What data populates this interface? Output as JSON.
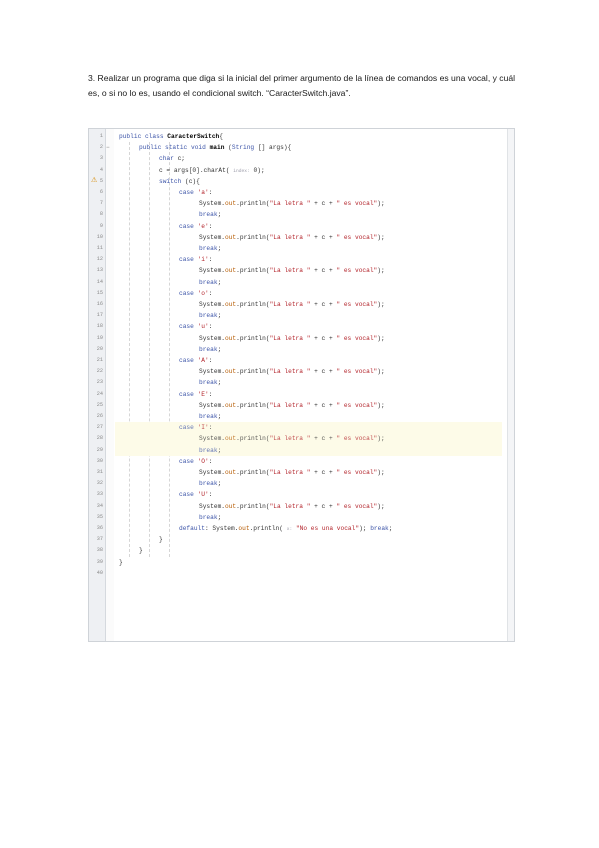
{
  "instruction": "3. Realizar un programa que diga si la inicial del primer argumento de la línea de comandos es una vocal, y cuál es, o si no lo es, usando el condicional switch. “CaracterSwitch.java”.",
  "code_lines": [
    {
      "n": "1",
      "html": "<span class='kw'>public class</span> <span class='bold'>CaracterSwitch</span>{",
      "indent": 0
    },
    {
      "n": "2",
      "html": "<span class='kw'>public static void</span> <span class='bold'>main</span> (<span class='kw'>String</span> [] args){",
      "indent": 1
    },
    {
      "n": "3",
      "html": "<span class='kw'>char</span> c;",
      "indent": 2
    },
    {
      "n": "4",
      "html": "c = args[0].charAt( <span class='hint'>index:</span> 0);",
      "indent": 2
    },
    {
      "n": "5",
      "html": "<span class='kw'>switch</span> (c){",
      "indent": 2
    },
    {
      "n": "6",
      "html": "<span class='kw'>case</span> <span class='str'>'a'</span>:",
      "indent": 3
    },
    {
      "n": "7",
      "html": "System.<span class='field'>out</span>.println(<span class='str'>\"La letra \"</span> + c + <span class='str'>\" es vocal\"</span>);",
      "indent": 4
    },
    {
      "n": "8",
      "html": "<span class='kw'>break</span>;",
      "indent": 4
    },
    {
      "n": "9",
      "html": "<span class='kw'>case</span> <span class='str'>'e'</span>:",
      "indent": 3
    },
    {
      "n": "10",
      "html": "System.<span class='field'>out</span>.println(<span class='str'>\"La letra \"</span> + c + <span class='str'>\" es vocal\"</span>);",
      "indent": 4
    },
    {
      "n": "11",
      "html": "<span class='kw'>break</span>;",
      "indent": 4
    },
    {
      "n": "12",
      "html": "<span class='kw'>case</span> <span class='str'>'i'</span>:",
      "indent": 3
    },
    {
      "n": "13",
      "html": "System.<span class='field'>out</span>.println(<span class='str'>\"La letra \"</span> + c + <span class='str'>\" es vocal\"</span>);",
      "indent": 4
    },
    {
      "n": "14",
      "html": "<span class='kw'>break</span>;",
      "indent": 4
    },
    {
      "n": "15",
      "html": "<span class='kw'>case</span> <span class='str'>'o'</span>:",
      "indent": 3
    },
    {
      "n": "16",
      "html": "System.<span class='field'>out</span>.println(<span class='str'>\"La letra \"</span> + c + <span class='str'>\" es vocal\"</span>);",
      "indent": 4
    },
    {
      "n": "17",
      "html": "<span class='kw'>break</span>;",
      "indent": 4
    },
    {
      "n": "18",
      "html": "<span class='kw'>case</span> <span class='str'>'u'</span>:",
      "indent": 3
    },
    {
      "n": "19",
      "html": "System.<span class='field'>out</span>.println(<span class='str'>\"La letra \"</span> + c + <span class='str'>\" es vocal\"</span>);",
      "indent": 4
    },
    {
      "n": "20",
      "html": "<span class='kw'>break</span>;",
      "indent": 4
    },
    {
      "n": "21",
      "html": "<span class='kw'>case</span> <span class='str'>'A'</span>:",
      "indent": 3
    },
    {
      "n": "22",
      "html": "System.<span class='field'>out</span>.println(<span class='str'>\"La letra \"</span> + c + <span class='str'>\" es vocal\"</span>);",
      "indent": 4
    },
    {
      "n": "23",
      "html": "<span class='kw'>break</span>;",
      "indent": 4
    },
    {
      "n": "24",
      "html": "<span class='kw'>case</span> <span class='str'>'E'</span>:",
      "indent": 3
    },
    {
      "n": "25",
      "html": "System.<span class='field'>out</span>.println(<span class='str'>\"La letra \"</span> + c + <span class='str'>\" es vocal\"</span>);",
      "indent": 4
    },
    {
      "n": "26",
      "html": "<span class='kw'>break</span>;",
      "indent": 4
    },
    {
      "n": "27",
      "html": "<span class='kw'>case</span> <span class='str'>'I'</span>:",
      "indent": 3
    },
    {
      "n": "28",
      "html": "System.<span class='field'>out</span>.println(<span class='str'>\"La letra \"</span> + c + <span class='str'>\" es vocal\"</span>);",
      "indent": 4
    },
    {
      "n": "29",
      "html": "<span class='kw'>break</span>;",
      "indent": 4
    },
    {
      "n": "30",
      "html": "<span class='kw'>case</span> <span class='str'>'O'</span>:",
      "indent": 3
    },
    {
      "n": "31",
      "html": "System.<span class='field'>out</span>.println(<span class='str'>\"La letra \"</span> + c + <span class='str'>\" es vocal\"</span>);",
      "indent": 4
    },
    {
      "n": "32",
      "html": "<span class='kw'>break</span>;",
      "indent": 4
    },
    {
      "n": "33",
      "html": "<span class='kw'>case</span> <span class='str'>'U'</span>:",
      "indent": 3
    },
    {
      "n": "34",
      "html": "System.<span class='field'>out</span>.println(<span class='str'>\"La letra \"</span> + c + <span class='str'>\" es vocal\"</span>);",
      "indent": 4
    },
    {
      "n": "35",
      "html": "<span class='kw'>break</span>;",
      "indent": 4
    },
    {
      "n": "36",
      "html": "<span class='kw'>default</span>: System.<span class='field'>out</span>.println( <span class='hint'>x:</span> <span class='str'>\"No es una vocal\"</span>); <span class='kw'>break</span>;",
      "indent": 3
    },
    {
      "n": "37",
      "html": "}",
      "indent": 2
    },
    {
      "n": "38",
      "html": "}",
      "indent": 1
    },
    {
      "n": "39",
      "html": "}",
      "indent": 0
    },
    {
      "n": "40",
      "html": "",
      "indent": 0
    }
  ]
}
